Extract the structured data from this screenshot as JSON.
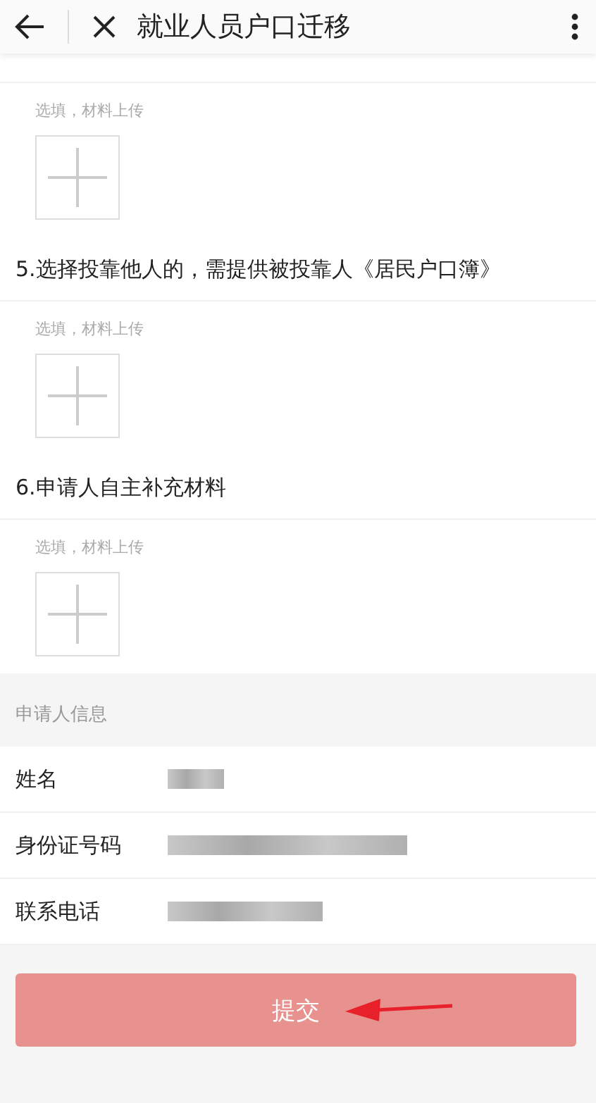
{
  "header": {
    "title": "就业人员户口迁移"
  },
  "uploads": [
    {
      "hint": "选填，材料上传"
    },
    {
      "title": "5.选择投靠他人的，需提供被投靠人《居民户口簿》",
      "hint": "选填，材料上传"
    },
    {
      "title": "6.申请人自主补充材料",
      "hint": "选填，材料上传"
    }
  ],
  "applicant": {
    "heading": "申请人信息",
    "rows": [
      {
        "label": "姓名"
      },
      {
        "label": "身份证号码"
      },
      {
        "label": "联系电话"
      }
    ]
  },
  "submit": {
    "label": "提交"
  }
}
